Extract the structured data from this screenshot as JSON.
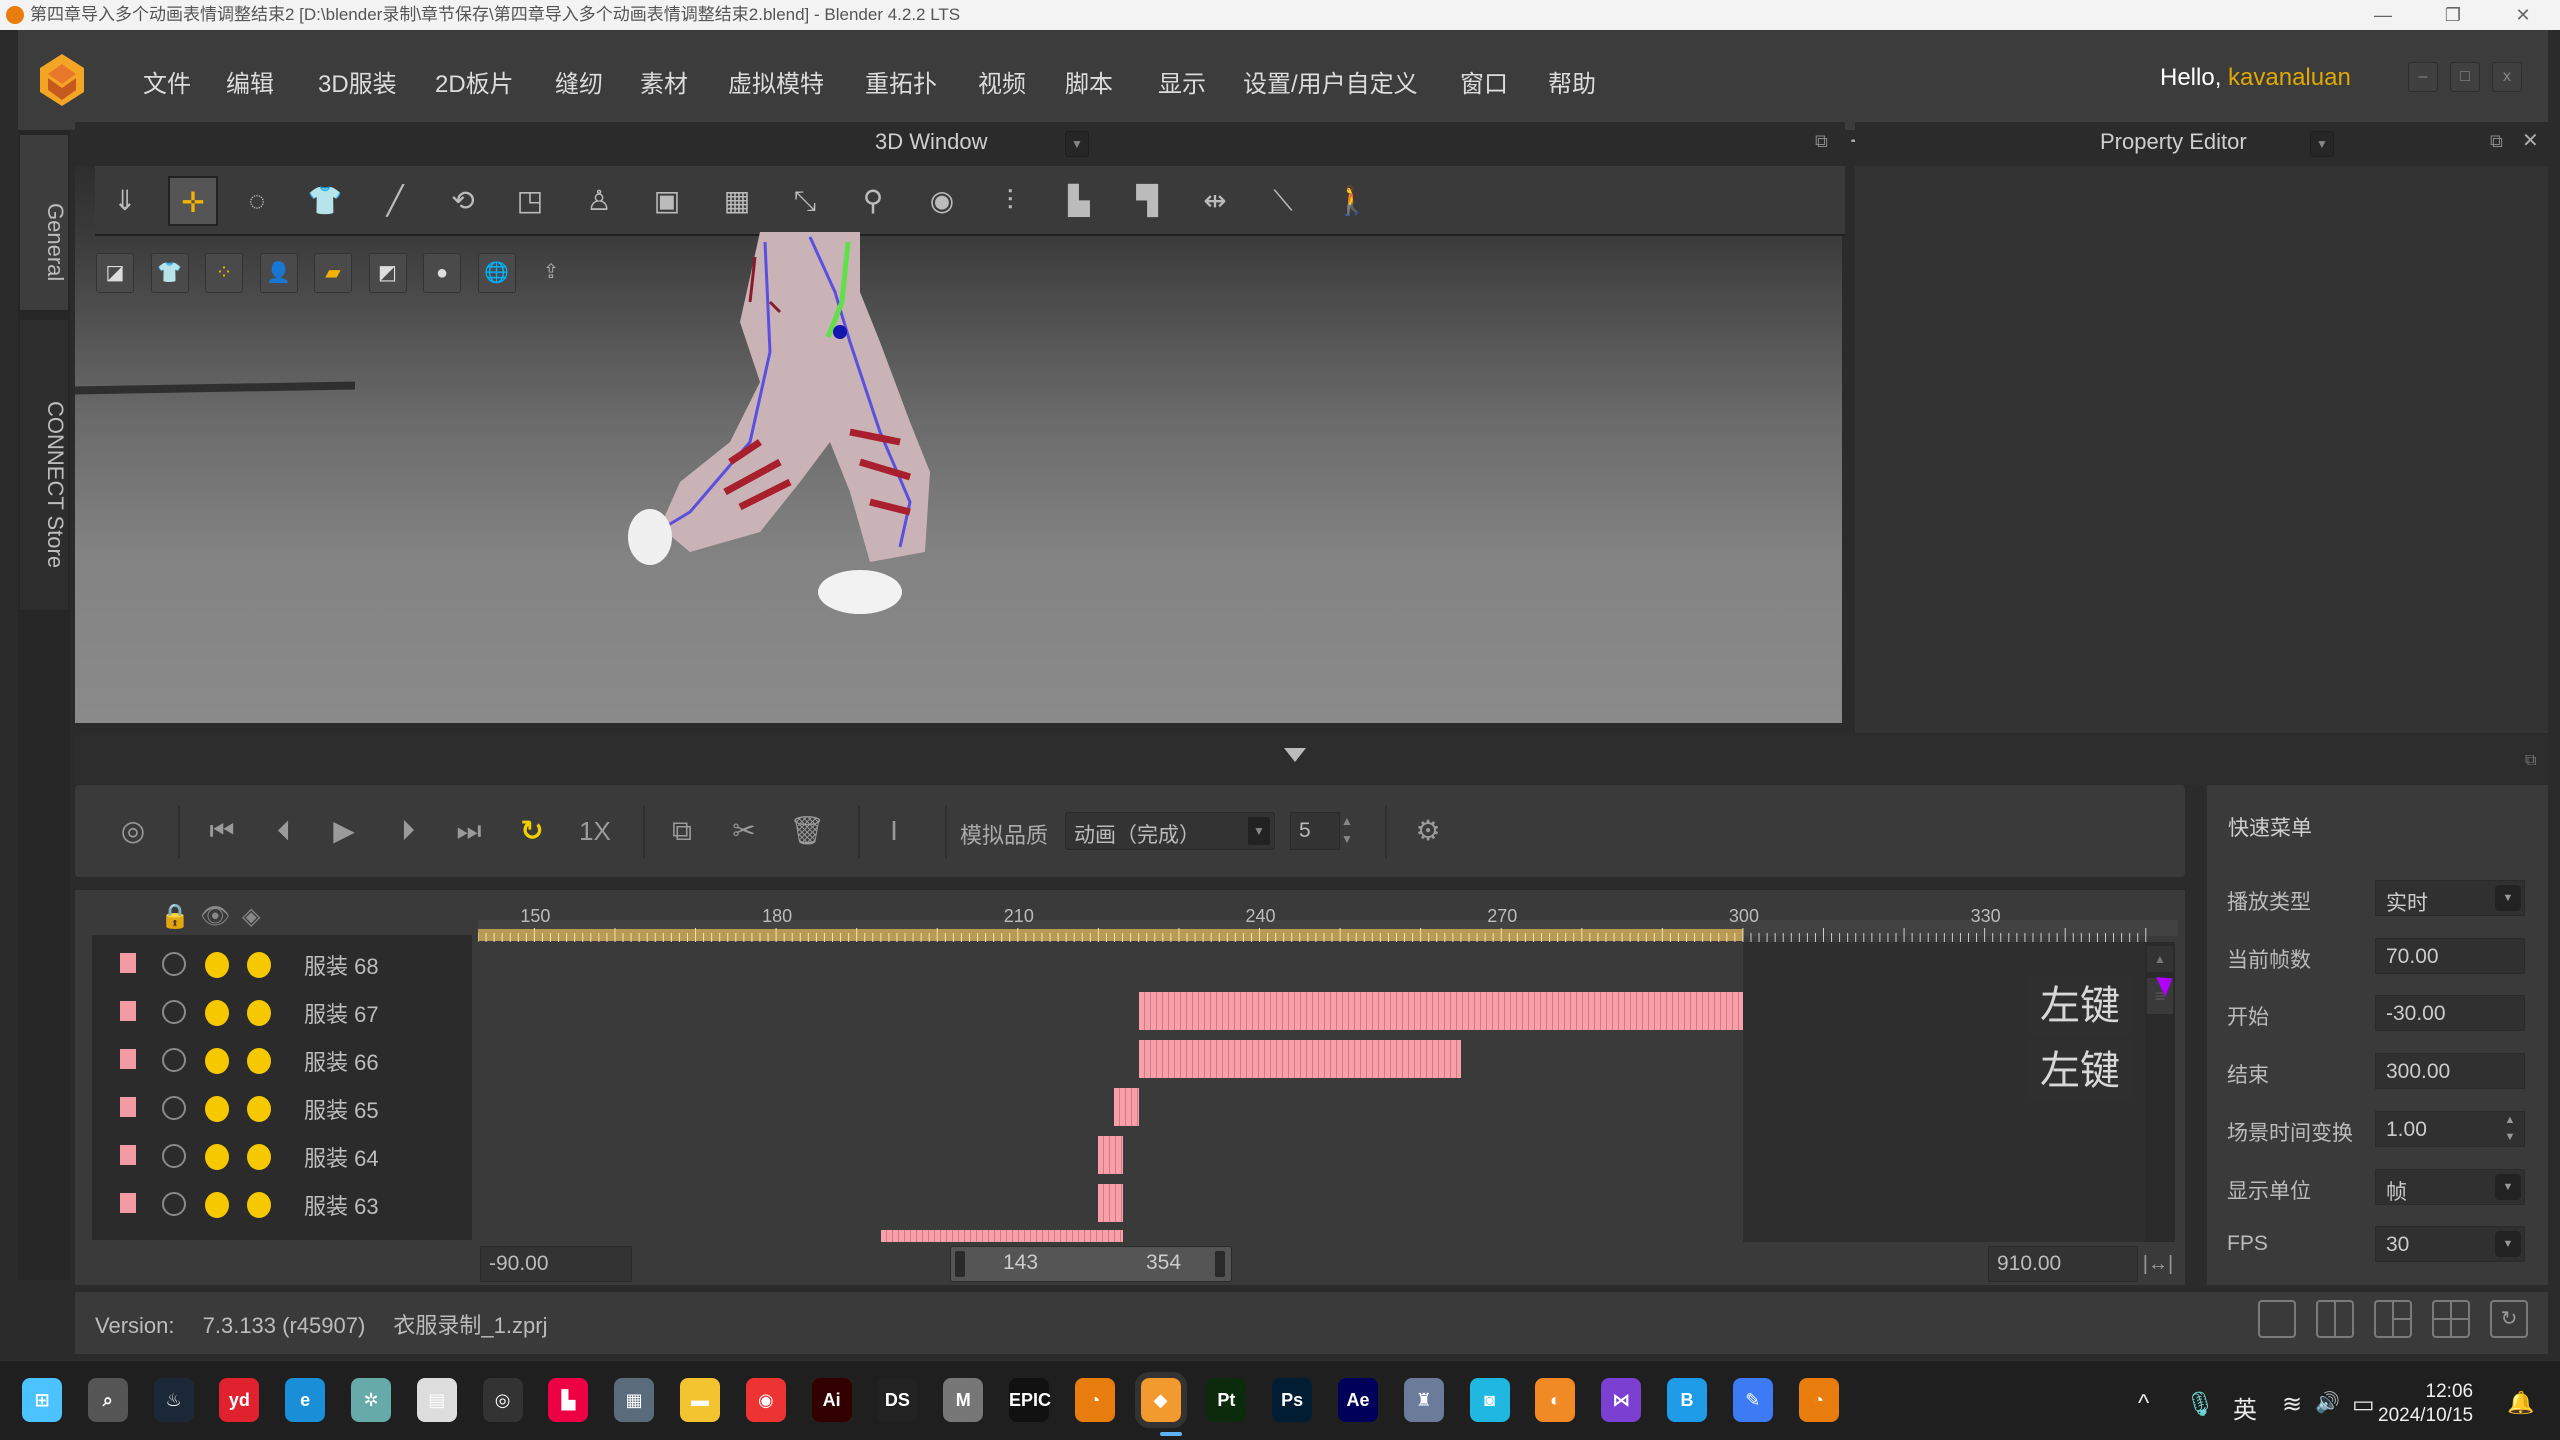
{
  "window": {
    "title": "第四章导入多个动画表情调整结束2 [D:\\blender录制\\章节保存\\第四章导入多个动画表情调整结束2.blend] - Blender 4.2.2 LTS",
    "controls": {
      "minimize": "—",
      "restore": "❐",
      "close": "✕"
    }
  },
  "menubar": {
    "items": [
      "文件",
      "编辑",
      "3D服装",
      "2D板片",
      "缝纫",
      "素材",
      "虚拟模特",
      "重拓扑",
      "视频",
      "脚本",
      "显示",
      "设置/用户自定义",
      "窗口",
      "帮助"
    ],
    "greeting": "Hello, ",
    "username": "kavanaluan",
    "username_color": "#e0a800",
    "app_controls": {
      "minimize": "–",
      "maximize": "□",
      "close": "x"
    }
  },
  "side_tabs": [
    "General",
    "CONNECT Store"
  ],
  "window3d": {
    "title": "3D Window",
    "dropdown": "▼",
    "toolbar_tools": [
      "simulate-icon",
      "select-move-icon",
      "lasso-select-icon",
      "select-garment-icon",
      "edit-pin-icon",
      "fold-arrangement-icon",
      "transform-icon",
      "avatar-arrangement-icon",
      "sew-icon",
      "grid-icon",
      "edit-curve-icon",
      "measure-icon",
      "button-icon",
      "zipper-icon",
      "tack-icon",
      "fold-icon",
      "stitch-icon",
      "tape-icon",
      "walk-icon"
    ],
    "toolbar_glyphs": [
      "⇓",
      "✛",
      "◌",
      "👕",
      "╱",
      "⟲",
      "◳",
      "♙",
      "▣",
      "▦",
      "⤡",
      "⚲",
      "◉",
      "⫶",
      "▙",
      "▜",
      "⇹",
      "⟍",
      "🚶"
    ],
    "view_tools": [
      "show-garment-icon",
      "show-avatar-icon",
      "show-points-icon",
      "avatar-toggle-icon",
      "texture-icon",
      "shading-icon",
      "head-icon",
      "globe-icon",
      "export-icon"
    ],
    "view_glyphs": [
      "◪",
      "👕",
      "⁘",
      "👤",
      "▰",
      "◩",
      "●",
      "🌐",
      "⇪"
    ]
  },
  "property_editor": {
    "title": "Property Editor",
    "dropdown": "▼"
  },
  "timeline": {
    "toolbar": {
      "record_icon": "◎",
      "buttons": [
        "⏮",
        "⏴",
        "▶",
        "⏵",
        "⏭"
      ],
      "loop_icon": "↻",
      "speed": "1X",
      "edit_buttons": [
        "⧉",
        "✂",
        "🗑"
      ],
      "marker_icon": "I",
      "quality_label": "模拟品质",
      "quality_value": "动画（完成）",
      "quality_num": "5",
      "settings_icon": "⚙"
    },
    "header_icons": {
      "lock": "🔒",
      "eye": "👁",
      "solo": "◈"
    },
    "ruler": {
      "ticks": [
        150,
        180,
        210,
        240,
        270,
        300,
        330
      ],
      "visible_start": 143,
      "visible_end": 354,
      "filled_until": 300
    },
    "tracks": [
      {
        "name": "服装 68",
        "clip": null
      },
      {
        "name": "服装 67",
        "clip": [
          225,
          300
        ]
      },
      {
        "name": "服装 66",
        "clip": [
          225,
          265
        ]
      },
      {
        "name": "服装 65",
        "clip": [
          222,
          225
        ]
      },
      {
        "name": "服装 64",
        "clip": [
          220,
          223
        ]
      },
      {
        "name": "服装 63",
        "clip": [
          220,
          223
        ]
      },
      {
        "name": "",
        "clip": [
          193,
          223
        ]
      }
    ],
    "hints": [
      "左键",
      "左键"
    ],
    "range": {
      "min": "-90.00",
      "start": "143",
      "end": "354",
      "max": "910.00"
    },
    "fit_icon": "|↔|"
  },
  "quick_menu": {
    "title": "快速菜单",
    "fields": [
      {
        "label": "播放类型",
        "value": "实时",
        "type": "dropdown"
      },
      {
        "label": "当前帧数",
        "value": "70.00",
        "type": "input"
      },
      {
        "label": "开始",
        "value": "-30.00",
        "type": "input"
      },
      {
        "label": "结束",
        "value": "300.00",
        "type": "input"
      },
      {
        "label": "场景时间变换",
        "value": "1.00",
        "type": "spin"
      },
      {
        "label": "显示单位",
        "value": "帧",
        "type": "dropdown"
      },
      {
        "label": "FPS",
        "value": "30",
        "type": "dropdown"
      }
    ]
  },
  "status": {
    "version_label": "Version:",
    "version": "7.3.133 (r45907)",
    "file": "衣服录制_1.zprj"
  },
  "layout_buttons": [
    "single-view",
    "split-view",
    "three-view",
    "quad-view",
    "reset-view"
  ],
  "taskbar": {
    "apps": [
      {
        "name": "start",
        "glyph": "⊞",
        "color": "#4cc2ff"
      },
      {
        "name": "search",
        "glyph": "⌕",
        "color": "#555"
      },
      {
        "name": "steam",
        "glyph": "♨",
        "color": "#1b2838"
      },
      {
        "name": "youdao",
        "glyph": "yd",
        "color": "#e0212e"
      },
      {
        "name": "edge",
        "glyph": "e",
        "color": "#1a8fd8"
      },
      {
        "name": "network",
        "glyph": "✲",
        "color": "#6aa"
      },
      {
        "name": "tool",
        "glyph": "▤",
        "color": "#ddd"
      },
      {
        "name": "obs",
        "glyph": "◎",
        "color": "#333"
      },
      {
        "name": "bookmark",
        "glyph": "▙",
        "color": "#e04"
      },
      {
        "name": "calculator",
        "glyph": "▦",
        "color": "#5a6b7c"
      },
      {
        "name": "explorer",
        "glyph": "▬",
        "color": "#f4c430"
      },
      {
        "name": "chrome",
        "glyph": "◉",
        "color": "#e33"
      },
      {
        "name": "illustrator",
        "glyph": "Ai",
        "color": "#300"
      },
      {
        "name": "daz",
        "glyph": "DS",
        "color": "#222"
      },
      {
        "name": "marvelous",
        "glyph": "M",
        "color": "#777"
      },
      {
        "name": "epic",
        "glyph": "EPIC",
        "color": "#111"
      },
      {
        "name": "blender",
        "glyph": "◔",
        "color": "#e87d0d"
      },
      {
        "name": "clo",
        "glyph": "◆",
        "color": "#f29a2e"
      },
      {
        "name": "painter",
        "glyph": "Pt",
        "color": "#0c2a0c"
      },
      {
        "name": "photoshop",
        "glyph": "Ps",
        "color": "#001d34"
      },
      {
        "name": "aftereffects",
        "glyph": "Ae",
        "color": "#00005b"
      },
      {
        "name": "game",
        "glyph": "♜",
        "color": "#6b7c9b"
      },
      {
        "name": "capture",
        "glyph": "◙",
        "color": "#20b7e0"
      },
      {
        "name": "app-orange",
        "glyph": "◐",
        "color": "#f08a24"
      },
      {
        "name": "visualstudio",
        "glyph": "⋈",
        "color": "#7b3fd1"
      },
      {
        "name": "bilibili",
        "glyph": "B",
        "color": "#1e9be7"
      },
      {
        "name": "note",
        "glyph": "✎",
        "color": "#3d7bf5"
      },
      {
        "name": "blender2",
        "glyph": "◔",
        "color": "#e87d0d"
      }
    ],
    "tray": {
      "chevron": "^",
      "mic": "🎙",
      "ime": "英",
      "wifi": "≋",
      "volume": "🔊",
      "battery": "▭",
      "notification": "🔔"
    },
    "time": "12:06",
    "date": "2024/10/15"
  }
}
